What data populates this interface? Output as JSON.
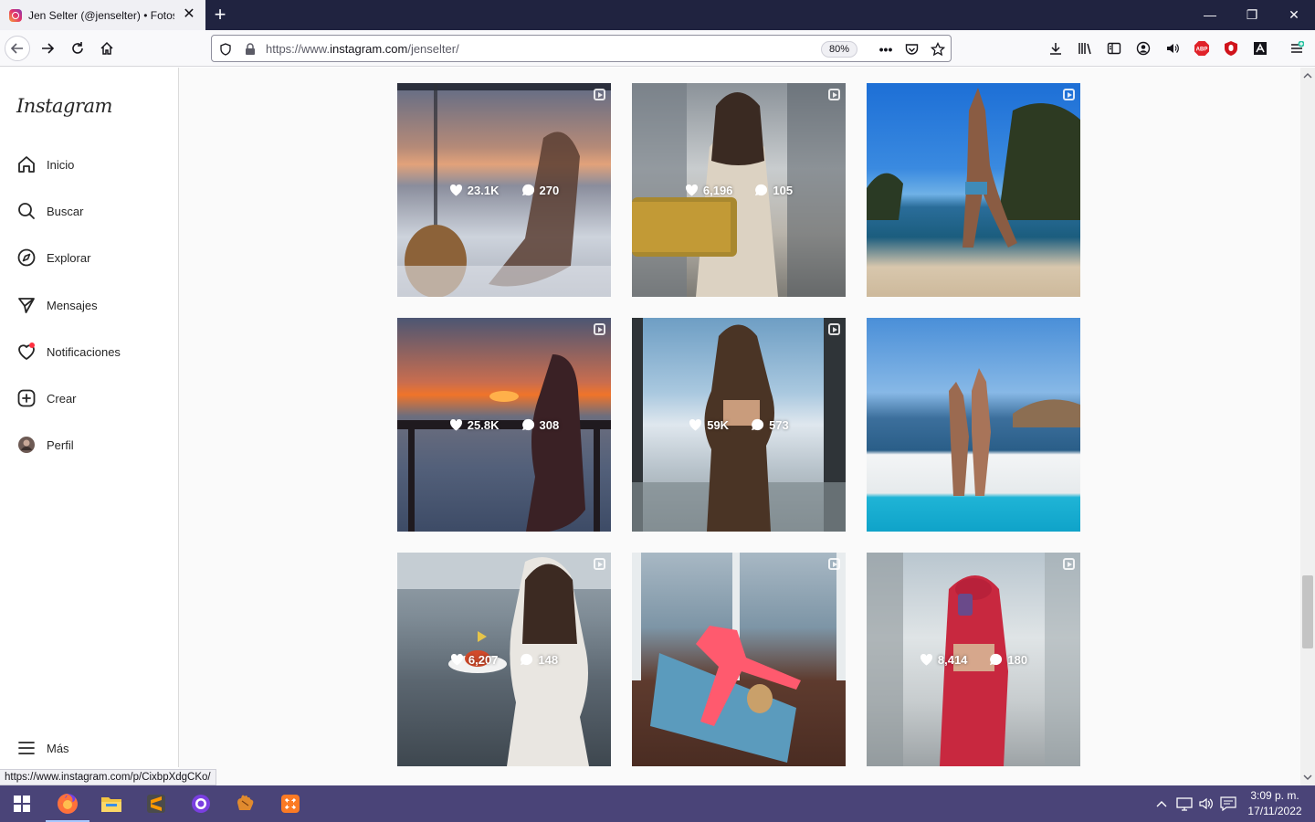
{
  "browser": {
    "tab_title": "Jen Selter (@jenselter) • Fotos y",
    "url_prefix": "https://www.",
    "url_domain": "instagram.com",
    "url_path": "/jenselter/",
    "zoom": "80%",
    "status_url": "https://www.instagram.com/p/CixbpXdgCKo/"
  },
  "sidebar": {
    "logo": "Instagram",
    "items": [
      {
        "label": "Inicio",
        "icon": "home-icon"
      },
      {
        "label": "Buscar",
        "icon": "search-icon"
      },
      {
        "label": "Explorar",
        "icon": "compass-icon"
      },
      {
        "label": "Mensajes",
        "icon": "direct-message-icon"
      },
      {
        "label": "Notificaciones",
        "icon": "heart-icon"
      },
      {
        "label": "Crear",
        "icon": "plus-square-icon"
      },
      {
        "label": "Perfil",
        "icon": "avatar"
      }
    ],
    "more_label": "Más"
  },
  "posts": [
    {
      "likes": "23.1K",
      "comments": "270",
      "reel": true
    },
    {
      "likes": "6,196",
      "comments": "105",
      "reel": true
    },
    {
      "likes": "",
      "comments": "",
      "reel": true
    },
    {
      "likes": "25.8K",
      "comments": "308",
      "reel": true
    },
    {
      "likes": "59K",
      "comments": "573",
      "reel": true
    },
    {
      "likes": "",
      "comments": "",
      "reel": false
    },
    {
      "likes": "6,207",
      "comments": "148",
      "reel": true
    },
    {
      "likes": "",
      "comments": "",
      "reel": true
    },
    {
      "likes": "8,414",
      "comments": "180",
      "reel": true
    }
  ],
  "taskbar": {
    "time": "3:09 p. m.",
    "date": "17/11/2022"
  },
  "colors": {
    "tab_strip": "#202340",
    "taskbar": "#4a4478",
    "notification_dot": "#ff3040"
  }
}
